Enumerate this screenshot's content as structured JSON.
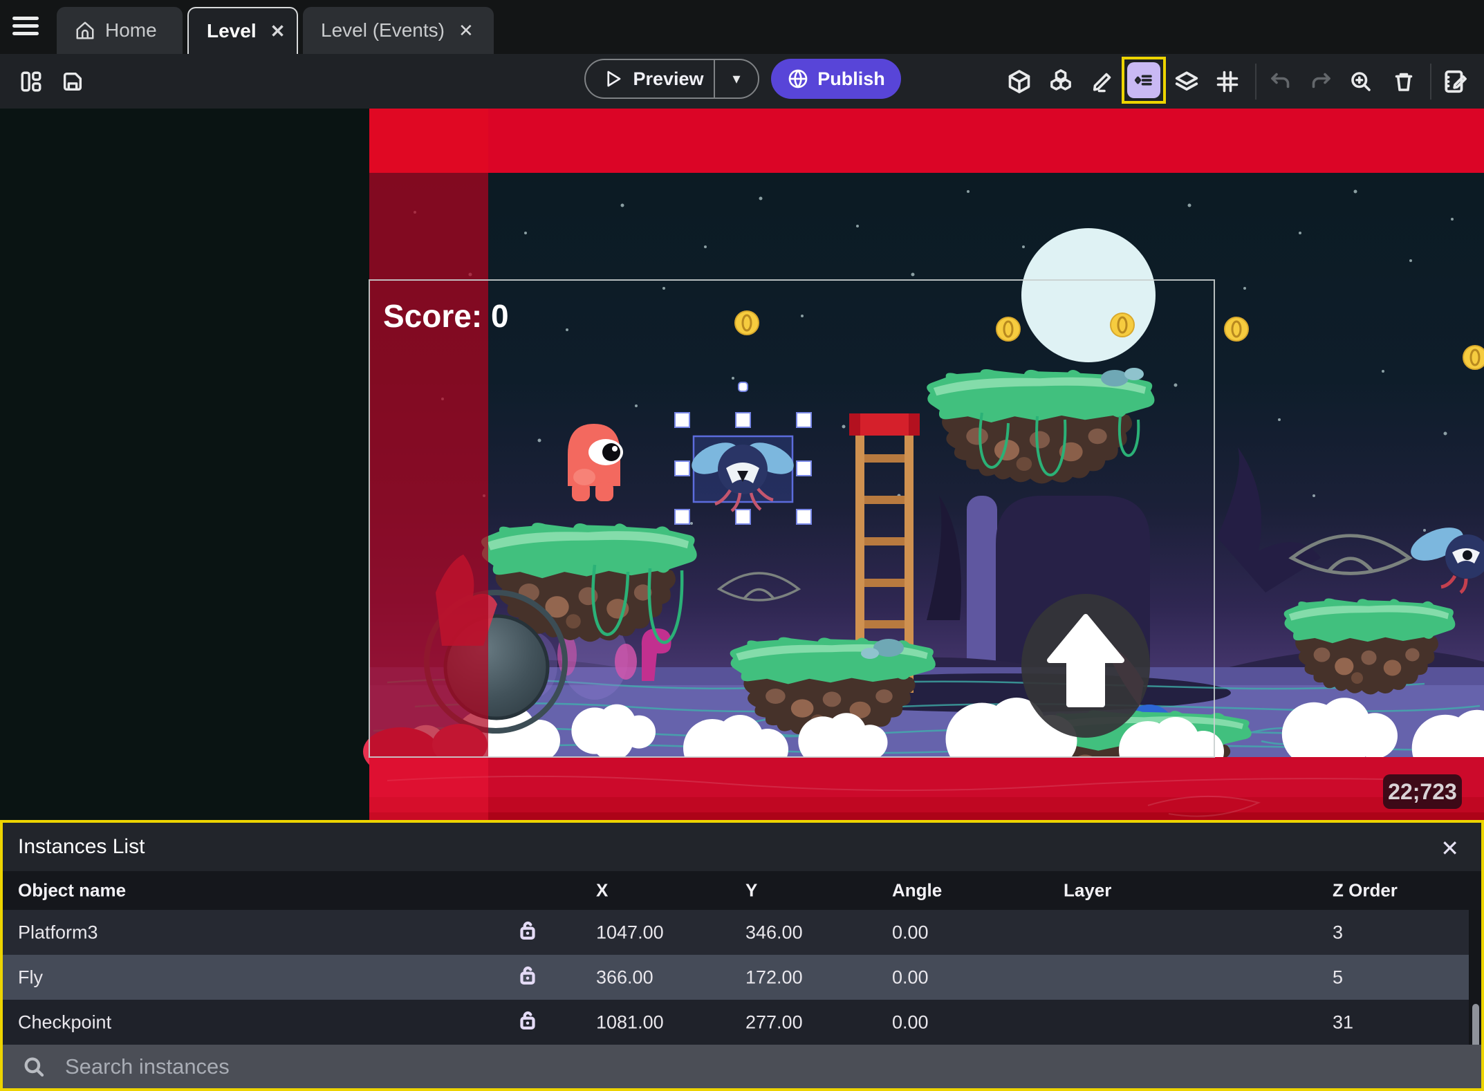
{
  "window": {
    "tabs": [
      {
        "label": "Home"
      },
      {
        "label": "Level",
        "active": true
      },
      {
        "label": "Level (Events)"
      }
    ]
  },
  "toolbar": {
    "preview_label": "Preview",
    "publish_label": "Publish"
  },
  "scene": {
    "score_label": "Score: 0",
    "coordinates_badge": "22;723"
  },
  "instances_panel": {
    "title": "Instances List",
    "columns": {
      "object_name": "Object name",
      "x": "X",
      "y": "Y",
      "angle": "Angle",
      "layer": "Layer",
      "z_order": "Z Order"
    },
    "rows": [
      {
        "name": "Platform3",
        "x": "1047.00",
        "y": "346.00",
        "angle": "0.00",
        "layer": "",
        "z_order": "3"
      },
      {
        "name": "Fly",
        "x": "366.00",
        "y": "172.00",
        "angle": "0.00",
        "layer": "",
        "z_order": "5",
        "selected": true
      },
      {
        "name": "Checkpoint",
        "x": "1081.00",
        "y": "277.00",
        "angle": "0.00",
        "layer": "",
        "z_order": "31"
      }
    ],
    "search_placeholder": "Search instances"
  },
  "icons": {
    "close": "✕",
    "caret_down": "▾"
  },
  "colors": {
    "accent_purple": "#5845d8",
    "highlight_yellow": "#edd400",
    "selected_row": "#454b58",
    "band_red": "#d90429",
    "panel_bg": "#1a1d23"
  }
}
